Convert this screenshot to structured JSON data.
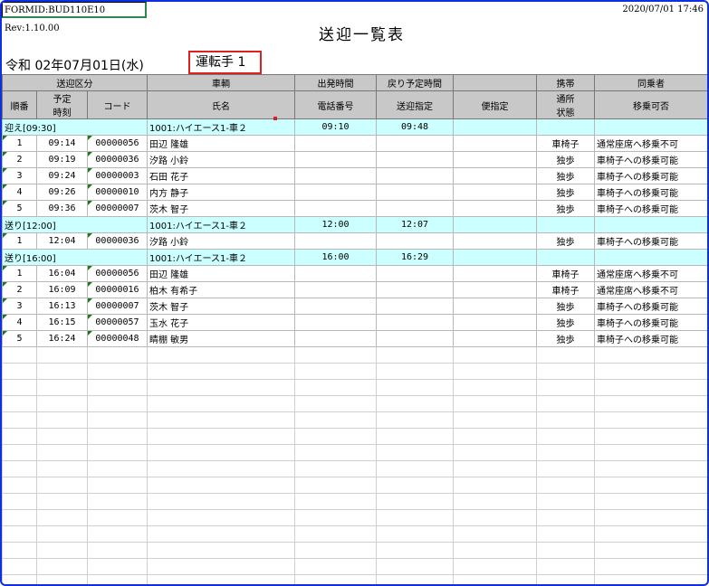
{
  "form_id": "FORMID:BUD110E10",
  "revision": "Rev:1.10.00",
  "print_date": "2020/07/01 17:46",
  "report_title": "送迎一覧表",
  "report_date": "令和 02年07月01日(水)",
  "driver_label": "運転手 1",
  "headers": {
    "row1": [
      "送迎区分",
      "車輌",
      "出発時間",
      "戻り予定時間",
      "携帯",
      "同乗者"
    ],
    "row2": [
      "順番",
      "予定\n時刻",
      "コード",
      "氏名",
      "電話番号",
      "送迎指定",
      "便指定",
      "通所\n状態",
      "移乗可否"
    ]
  },
  "groups": [
    {
      "label": "迎え[09:30]",
      "vehicle": "1001:ハイエース1-車２",
      "depart": "09:10",
      "return": "09:48",
      "rows": [
        {
          "no": "1",
          "time": "09:14",
          "code": "00000056",
          "name": "田辺 隆雄",
          "status": "車椅子",
          "transfer": "通常座席へ移乗不可"
        },
        {
          "no": "2",
          "time": "09:19",
          "code": "00000036",
          "name": "汐路 小鈴",
          "status": "独歩",
          "transfer": "車椅子への移乗可能"
        },
        {
          "no": "3",
          "time": "09:24",
          "code": "00000003",
          "name": "石田 花子",
          "status": "独歩",
          "transfer": "車椅子への移乗可能"
        },
        {
          "no": "4",
          "time": "09:26",
          "code": "00000010",
          "name": "内方 静子",
          "status": "独歩",
          "transfer": "車椅子への移乗可能"
        },
        {
          "no": "5",
          "time": "09:36",
          "code": "00000007",
          "name": "茨木 智子",
          "status": "独歩",
          "transfer": "車椅子への移乗可能"
        }
      ]
    },
    {
      "label": "送り[12:00]",
      "vehicle": "1001:ハイエース1-車２",
      "depart": "12:00",
      "return": "12:07",
      "rows": [
        {
          "no": "1",
          "time": "12:04",
          "code": "00000036",
          "name": "汐路 小鈴",
          "status": "独歩",
          "transfer": "車椅子への移乗可能"
        }
      ]
    },
    {
      "label": "送り[16:00]",
      "vehicle": "1001:ハイエース1-車２",
      "depart": "16:00",
      "return": "16:29",
      "rows": [
        {
          "no": "1",
          "time": "16:04",
          "code": "00000056",
          "name": "田辺 隆雄",
          "status": "車椅子",
          "transfer": "通常座席へ移乗不可"
        },
        {
          "no": "2",
          "time": "16:09",
          "code": "00000016",
          "name": "柏木 有希子",
          "status": "車椅子",
          "transfer": "通常座席へ移乗不可"
        },
        {
          "no": "3",
          "time": "16:13",
          "code": "00000007",
          "name": "茨木 智子",
          "status": "独歩",
          "transfer": "車椅子への移乗可能"
        },
        {
          "no": "4",
          "time": "16:15",
          "code": "00000057",
          "name": "玉水 花子",
          "status": "独歩",
          "transfer": "車椅子への移乗可能"
        },
        {
          "no": "5",
          "time": "16:24",
          "code": "00000048",
          "name": "睛棚 敏男",
          "status": "独歩",
          "transfer": "車椅子への移乗可能"
        }
      ]
    }
  ]
}
